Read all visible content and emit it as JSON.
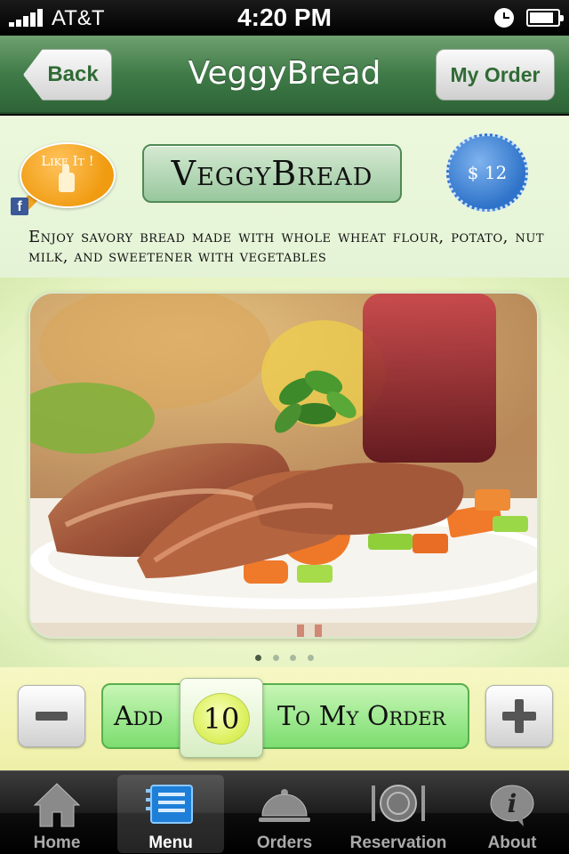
{
  "status_bar": {
    "carrier": "AT&T",
    "time": "4:20 PM"
  },
  "nav_bar": {
    "back_label": "Back",
    "title": "VeggyBread",
    "my_order_label": "My Order"
  },
  "item": {
    "like_label": "Like It !",
    "name": "VeggyBread",
    "price": "$ 12",
    "description": "Enjoy savory bread made with whole wheat flour, potato, nut milk, and sweetener with vegetables"
  },
  "gallery": {
    "page_count": 4,
    "current_page": 1
  },
  "order": {
    "add_label": "Add",
    "quantity": "10",
    "to_order_label": "To My Order"
  },
  "tabs": [
    {
      "label": "Home",
      "icon": "home-icon",
      "selected": false
    },
    {
      "label": "Menu",
      "icon": "menu-icon",
      "selected": true
    },
    {
      "label": "Orders",
      "icon": "cloche-icon",
      "selected": false
    },
    {
      "label": "Reservation",
      "icon": "plate-cutlery-icon",
      "selected": false
    },
    {
      "label": "About",
      "icon": "info-icon",
      "selected": false
    }
  ],
  "colors": {
    "nav_green": "#3f7b48",
    "add_button_green": "#7cdd70",
    "price_blue": "#2e73c9",
    "like_orange": "#f09b10",
    "facebook_blue": "#3b5998"
  }
}
